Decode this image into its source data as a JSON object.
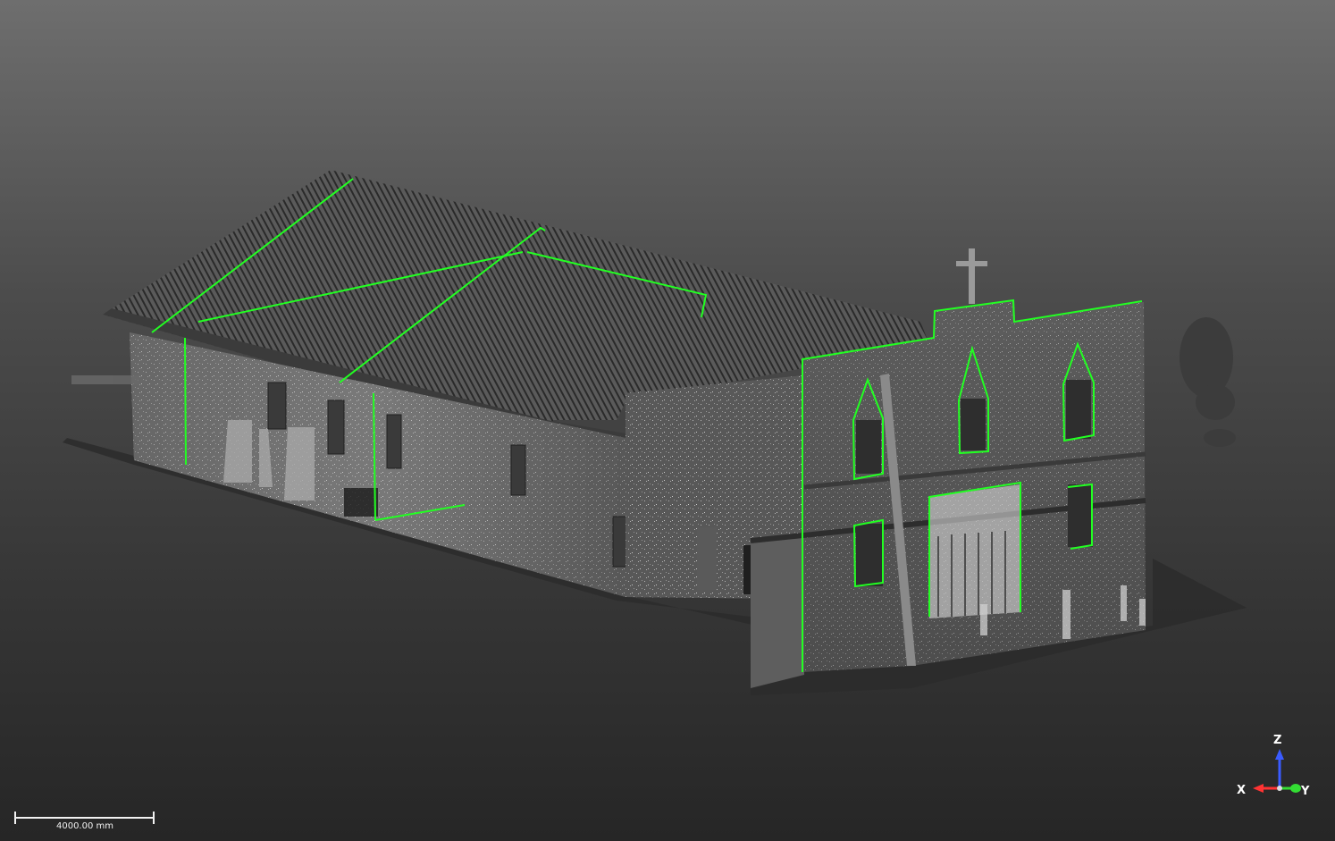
{
  "viewer": {
    "background_top": "#6e6e6e",
    "background_bottom": "#262626",
    "highlight_color": "#22ff22",
    "point_color": "#bdbdbd"
  },
  "scale_bar": {
    "label": "4000.00 mm"
  },
  "axis_triad": {
    "z_label": "Z",
    "x_label": "X",
    "y_label": "Y",
    "z_color": "#3a5bff",
    "x_color": "#ff3333",
    "y_color": "#33dd33"
  }
}
